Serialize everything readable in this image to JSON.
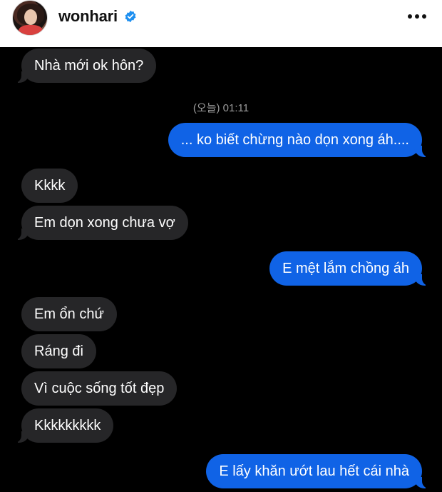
{
  "header": {
    "username": "wonhari",
    "verified_icon": "verified-badge-icon",
    "more_icon": "more-options-icon",
    "accent": "#1063e6"
  },
  "chat": {
    "timestamp": "(오늘) 01:11",
    "messages": [
      {
        "direction": "incoming",
        "text": "Nhà mới ok hôn?"
      },
      {
        "direction": "outgoing",
        "text": "... ko biết chừng nào dọn xong áh...."
      },
      {
        "direction": "incoming",
        "text": "Kkkk"
      },
      {
        "direction": "incoming",
        "text": "Em dọn xong chưa vợ"
      },
      {
        "direction": "outgoing",
        "text": "E mệt lắm chồng áh"
      },
      {
        "direction": "incoming",
        "text": "Em ổn chứ"
      },
      {
        "direction": "incoming",
        "text": "Ráng đi"
      },
      {
        "direction": "incoming",
        "text": "Vì cuộc sống tốt đẹp"
      },
      {
        "direction": "incoming",
        "text": "Kkkkkkkkk"
      },
      {
        "direction": "outgoing",
        "text": "E lấy khăn ướt lau hết cái nhà"
      }
    ]
  }
}
